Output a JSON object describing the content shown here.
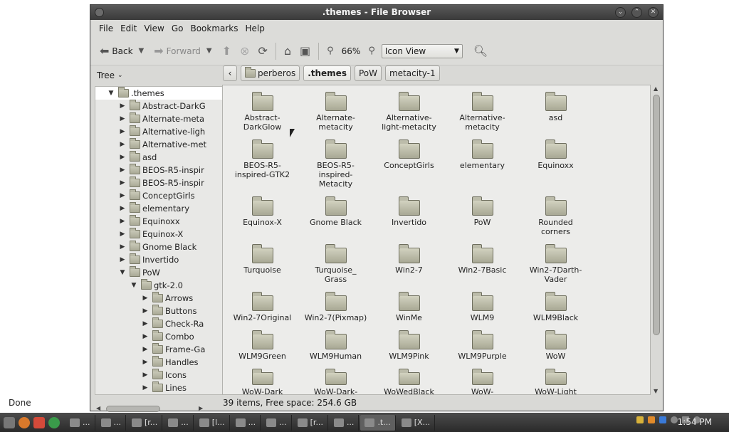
{
  "window": {
    "title": ".themes - File Browser"
  },
  "menu": [
    "File",
    "Edit",
    "View",
    "Go",
    "Bookmarks",
    "Help"
  ],
  "toolbar": {
    "back": "Back",
    "forward": "Forward",
    "zoom": "66%",
    "view_mode": "Icon View"
  },
  "side": {
    "mode": "Tree",
    "tree": [
      {
        "label": ".themes",
        "depth": 0,
        "expanded": true
      },
      {
        "label": "Abstract-DarkG",
        "depth": 1
      },
      {
        "label": "Alternate-meta",
        "depth": 1
      },
      {
        "label": "Alternative-ligh",
        "depth": 1
      },
      {
        "label": "Alternative-met",
        "depth": 1
      },
      {
        "label": "asd",
        "depth": 1
      },
      {
        "label": "BEOS-R5-inspir",
        "depth": 1
      },
      {
        "label": "BEOS-R5-inspir",
        "depth": 1
      },
      {
        "label": "ConceptGirls",
        "depth": 1
      },
      {
        "label": "elementary",
        "depth": 1
      },
      {
        "label": "Equinoxx",
        "depth": 1
      },
      {
        "label": "Equinox-X",
        "depth": 1
      },
      {
        "label": "Gnome Black",
        "depth": 1
      },
      {
        "label": "Invertido",
        "depth": 1
      },
      {
        "label": "PoW",
        "depth": 1,
        "expanded": true
      },
      {
        "label": "gtk-2.0",
        "depth": 2,
        "expanded": true
      },
      {
        "label": "Arrows",
        "depth": 3
      },
      {
        "label": "Buttons",
        "depth": 3
      },
      {
        "label": "Check-Ra",
        "depth": 3
      },
      {
        "label": "Combo",
        "depth": 3
      },
      {
        "label": "Frame-Ga",
        "depth": 3
      },
      {
        "label": "Handles",
        "depth": 3
      },
      {
        "label": "Icons",
        "depth": 3
      },
      {
        "label": "Lines",
        "depth": 3
      }
    ]
  },
  "pathbar": {
    "items": [
      "perberos",
      ".themes",
      "PoW",
      "metacity-1"
    ]
  },
  "icons": [
    "Abstract-\nDarkGlow",
    "Alternate-\nmetacity",
    "Alternative-\nlight-metacity",
    "Alternative-\nmetacity",
    "asd",
    "BEOS-R5-\ninspired-GTK2",
    "BEOS-R5-\ninspired-\nMetacity",
    "ConceptGirls",
    "elementary",
    "Equinoxx",
    "Equinox-X",
    "Gnome Black",
    "Invertido",
    "PoW",
    "Rounded\ncorners",
    "Turquoise",
    "Turquoise_\nGrass",
    "Win2-7",
    "Win2-7Basic",
    "Win2-7Darth-\nVader",
    "Win2-7Original",
    "Win2-7(Pixmap)",
    "WinMe",
    "WLM9",
    "WLM9Black",
    "WLM9Green",
    "WLM9Human",
    "WLM9Pink",
    "WLM9Purple",
    "WoW",
    "WoW-Dark",
    "WoW-Dark-",
    "WoWedBlack",
    "WoW-",
    "WoW-Light"
  ],
  "status": {
    "summary": "39 items, Free space: 254.6 GB",
    "left": "Done"
  },
  "taskbar": {
    "clock": "1:54 PM",
    "tasks": [
      "...",
      "...",
      "[r...",
      "...",
      "[l...",
      "...",
      "...",
      "[r...",
      "...",
      ".t...",
      "[X..."
    ]
  },
  "colors": {
    "window_bg": "#d9d9d6",
    "titlebar": "#3a3a3a",
    "taskbar": "#2a2a2a"
  }
}
